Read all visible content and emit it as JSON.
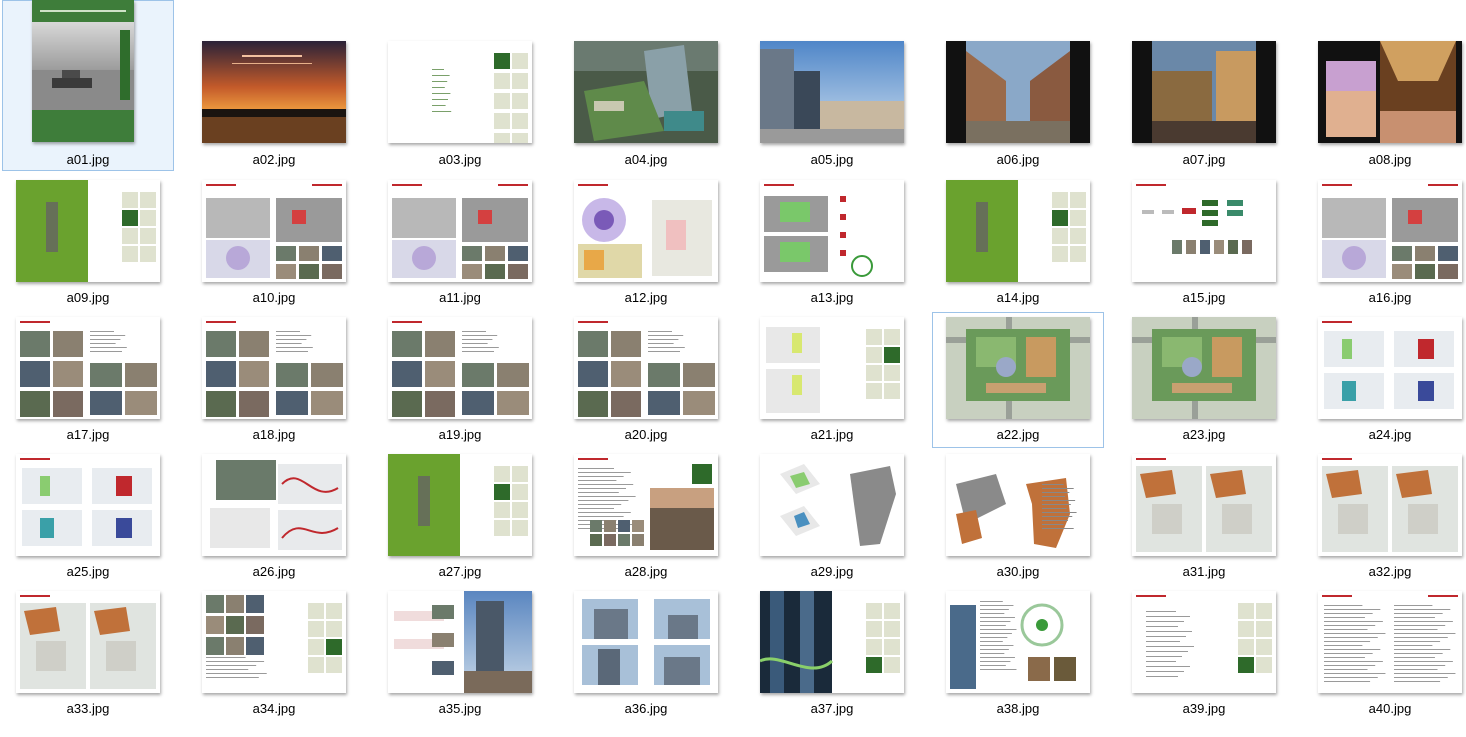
{
  "files": [
    {
      "name": "a01.jpg",
      "kind": "cover",
      "selected": true
    },
    {
      "name": "a02.jpg",
      "kind": "sunset"
    },
    {
      "name": "a03.jpg",
      "kind": "toc"
    },
    {
      "name": "a04.jpg",
      "kind": "aerial"
    },
    {
      "name": "a05.jpg",
      "kind": "tower"
    },
    {
      "name": "a06.jpg",
      "kind": "street"
    },
    {
      "name": "a07.jpg",
      "kind": "street2"
    },
    {
      "name": "a08.jpg",
      "kind": "mall"
    },
    {
      "name": "a09.jpg",
      "kind": "chapter"
    },
    {
      "name": "a10.jpg",
      "kind": "layout"
    },
    {
      "name": "a11.jpg",
      "kind": "layout"
    },
    {
      "name": "a12.jpg",
      "kind": "map"
    },
    {
      "name": "a13.jpg",
      "kind": "swot"
    },
    {
      "name": "a14.jpg",
      "kind": "chapter"
    },
    {
      "name": "a15.jpg",
      "kind": "flow"
    },
    {
      "name": "a16.jpg",
      "kind": "layout"
    },
    {
      "name": "a17.jpg",
      "kind": "photos"
    },
    {
      "name": "a18.jpg",
      "kind": "photos"
    },
    {
      "name": "a19.jpg",
      "kind": "photos"
    },
    {
      "name": "a20.jpg",
      "kind": "photos"
    },
    {
      "name": "a21.jpg",
      "kind": "grid"
    },
    {
      "name": "a22.jpg",
      "kind": "plan",
      "highlight": true
    },
    {
      "name": "a23.jpg",
      "kind": "plan"
    },
    {
      "name": "a24.jpg",
      "kind": "diagrams"
    },
    {
      "name": "a25.jpg",
      "kind": "diagrams"
    },
    {
      "name": "a26.jpg",
      "kind": "curves"
    },
    {
      "name": "a27.jpg",
      "kind": "chapter"
    },
    {
      "name": "a28.jpg",
      "kind": "text-photo"
    },
    {
      "name": "a29.jpg",
      "kind": "massing"
    },
    {
      "name": "a30.jpg",
      "kind": "massing2"
    },
    {
      "name": "a31.jpg",
      "kind": "floorplan"
    },
    {
      "name": "a32.jpg",
      "kind": "floorplan"
    },
    {
      "name": "a33.jpg",
      "kind": "floorplan"
    },
    {
      "name": "a34.jpg",
      "kind": "grid2"
    },
    {
      "name": "a35.jpg",
      "kind": "tower2"
    },
    {
      "name": "a36.jpg",
      "kind": "elevations"
    },
    {
      "name": "a37.jpg",
      "kind": "night"
    },
    {
      "name": "a38.jpg",
      "kind": "circle"
    },
    {
      "name": "a39.jpg",
      "kind": "text"
    },
    {
      "name": "a40.jpg",
      "kind": "text2"
    }
  ],
  "colors": {
    "green": "#3e7d3a",
    "chapterGreen": "#6aa22e",
    "darkGreen": "#2e6a2a",
    "red": "#c0282d",
    "orange": "#c0713a",
    "pale": "#dfe2cf"
  }
}
